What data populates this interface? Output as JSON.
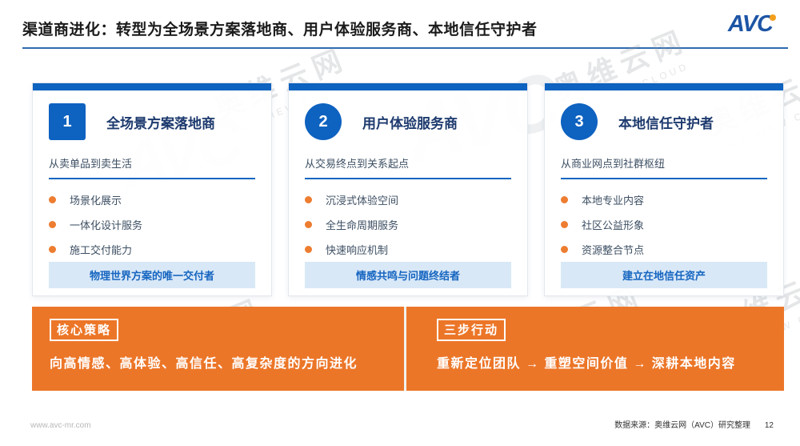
{
  "header": {
    "title": "渠道商进化：转型为全场景方案落地商、用户体验服务商、本地信任守护者",
    "logo_text": "AVC"
  },
  "cards": [
    {
      "number": "1",
      "title": "全场景方案落地商",
      "subtitle": "从卖单品到卖生活",
      "bullets": [
        "场景化展示",
        "一体化设计服务",
        "施工交付能力"
      ],
      "highlight": "物理世界方案的唯一交付者"
    },
    {
      "number": "2",
      "title": "用户体验服务商",
      "subtitle": "从交易终点到关系起点",
      "bullets": [
        "沉浸式体验空间",
        "全生命周期服务",
        "快速响应机制"
      ],
      "highlight": "情感共鸣与问题终结者"
    },
    {
      "number": "3",
      "title": "本地信任守护者",
      "subtitle": "从商业网点到社群枢纽",
      "bullets": [
        "本地专业内容",
        "社区公益形象",
        "资源整合节点"
      ],
      "highlight": "建立在地信任资产"
    }
  ],
  "strategy_panel": {
    "label": "核心策略",
    "text": "向高情感、高体验、高信任、高复杂度的方向进化"
  },
  "action_panel": {
    "label": "三步行动",
    "text": "重新定位团队 → 重塑空间价值 → 深耕本地内容"
  },
  "footer": {
    "website": "www.avc-mr.com",
    "source": "数据来源：奥维云网（AVC）研究整理",
    "page_number": "12"
  },
  "watermark": {
    "cn": "奥维云网",
    "en": "ALL VIEW CLOUD",
    "logo": "AVC"
  },
  "colors": {
    "accent_blue": "#0e62c0",
    "title_navy": "#1d3a6e",
    "orange": "#ec7628",
    "bullet_orange": "#ed7d31",
    "highlight_bg": "#d9e8f7",
    "highlight_text": "#1565c0",
    "rule_blue": "#2d6bb0",
    "logo_blue": "#1d55a5",
    "logo_dot_orange": "#f49f1c"
  }
}
